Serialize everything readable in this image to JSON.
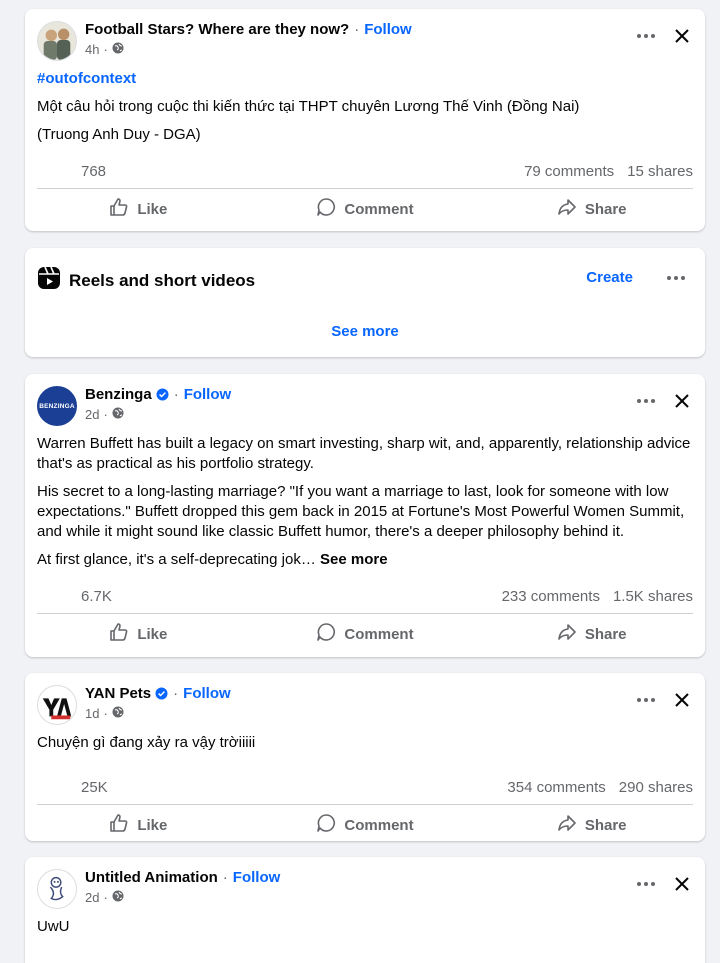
{
  "posts": [
    {
      "author": "Football Stars? Where are they now?",
      "follow": "Follow",
      "time": "4h",
      "hashtag": "#outofcontext",
      "lines": [
        "Một câu hỏi trong cuộc thi kiến thức tại THPT chuyên Lương Thế Vinh (Đồng Nai)",
        "(Truong Anh Duy - DGA)"
      ],
      "reactions": "768",
      "comments": "79 comments",
      "shares": "15 shares"
    },
    {
      "author": "Benzinga",
      "avatar_text": "BENZINGA",
      "follow": "Follow",
      "time": "2d",
      "lines": [
        "Warren Buffett has built a legacy on smart investing, sharp wit, and, apparently, relationship advice that's as practical as his portfolio strategy.",
        "His secret to a long-lasting marriage? \"If you want a marriage to last, look for someone with low expectations.\" Buffett dropped this gem back in 2015 at Fortune's Most Powerful Women Summit, and while it might sound like classic Buffett humor, there's a deeper philosophy behind it."
      ],
      "truncated": "At first glance, it's a self-deprecating jok…",
      "see_more": "See more",
      "reactions": "6.7K",
      "comments": "233 comments",
      "shares": "1.5K shares"
    },
    {
      "author": "YAN Pets",
      "follow": "Follow",
      "time": "1d",
      "lines": [
        "Chuyện gì đang xảy ra vậy trờiiiii"
      ],
      "reactions": "25K",
      "comments": "354 comments",
      "shares": "290 shares"
    },
    {
      "author": "Untitled Animation",
      "follow": "Follow",
      "time": "2d",
      "lines": [
        "UwU"
      ]
    }
  ],
  "actions": {
    "like": "Like",
    "comment": "Comment",
    "share": "Share"
  },
  "reels": {
    "title": "Reels and short videos",
    "create": "Create",
    "see_more": "See more"
  },
  "colors": {
    "accent": "#0866ff",
    "secondary_text": "#65676b",
    "background": "#f0f2f5"
  },
  "icons": [
    "more-icon",
    "close-icon",
    "globe-icon",
    "like-icon",
    "comment-icon",
    "share-icon",
    "reels-icon",
    "verified-icon"
  ]
}
